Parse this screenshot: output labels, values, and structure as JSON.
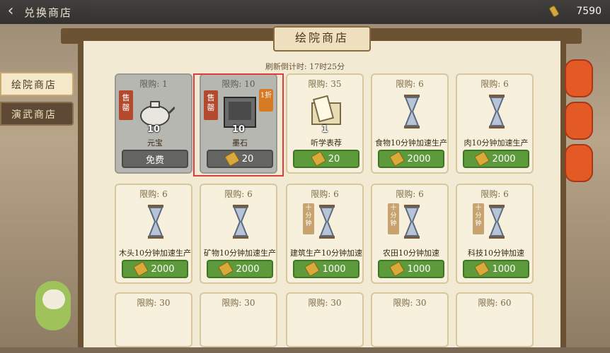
{
  "header": {
    "title": "兑换商店",
    "currency_amount": "7590",
    "back_icon": "chevron-left-icon",
    "currency_icon": "scroll-coin-icon"
  },
  "shop": {
    "title": "绘院商店",
    "refresh": "刷新倒计时: 17时25分"
  },
  "tabs": [
    {
      "label": "绘院商店",
      "active": true
    },
    {
      "label": "演武商店",
      "active": false
    }
  ],
  "items": [
    {
      "limit": "限购: 1",
      "qty": "10",
      "name": "元宝",
      "price": "免费",
      "sold": true,
      "stamp": "售罄",
      "discount": "",
      "tag": ""
    },
    {
      "limit": "限购: 10",
      "qty": "10",
      "name": "墨石",
      "price": "20",
      "sold": true,
      "stamp": "售罄",
      "discount": "1折",
      "tag": ""
    },
    {
      "limit": "限购: 35",
      "qty": "1",
      "name": "听学表荐",
      "price": "20",
      "sold": false,
      "stamp": "",
      "discount": "",
      "tag": ""
    },
    {
      "limit": "限购: 6",
      "qty": "",
      "name": "食物10分钟加速生产",
      "price": "2000",
      "sold": false,
      "stamp": "",
      "discount": "",
      "tag": ""
    },
    {
      "limit": "限购: 6",
      "qty": "",
      "name": "肉10分钟加速生产",
      "price": "2000",
      "sold": false,
      "stamp": "",
      "discount": "",
      "tag": ""
    },
    {
      "limit": "限购: 6",
      "qty": "",
      "name": "木头10分钟加速生产",
      "price": "2000",
      "sold": false,
      "stamp": "",
      "discount": "",
      "tag": ""
    },
    {
      "limit": "限购: 6",
      "qty": "",
      "name": "矿物10分钟加速生产",
      "price": "2000",
      "sold": false,
      "stamp": "",
      "discount": "",
      "tag": ""
    },
    {
      "limit": "限购: 6",
      "qty": "",
      "name": "建筑生产10分钟加速",
      "price": "1000",
      "sold": false,
      "stamp": "",
      "discount": "",
      "tag": "十分钟"
    },
    {
      "limit": "限购: 6",
      "qty": "",
      "name": "农田10分钟加速",
      "price": "1000",
      "sold": false,
      "stamp": "",
      "discount": "",
      "tag": "十分钟"
    },
    {
      "limit": "限购: 6",
      "qty": "",
      "name": "科技10分钟加速",
      "price": "1000",
      "sold": false,
      "stamp": "",
      "discount": "",
      "tag": "十分钟"
    },
    {
      "limit": "限购: 30",
      "qty": "",
      "name": "",
      "price": "",
      "sold": false,
      "stamp": "",
      "discount": "",
      "tag": ""
    },
    {
      "limit": "限购: 30",
      "qty": "",
      "name": "",
      "price": "",
      "sold": false,
      "stamp": "",
      "discount": "",
      "tag": ""
    },
    {
      "limit": "限购: 30",
      "qty": "",
      "name": "",
      "price": "",
      "sold": false,
      "stamp": "",
      "discount": "",
      "tag": ""
    },
    {
      "limit": "限购: 30",
      "qty": "",
      "name": "",
      "price": "",
      "sold": false,
      "stamp": "",
      "discount": "",
      "tag": ""
    },
    {
      "limit": "限购: 60",
      "qty": "",
      "name": "",
      "price": "",
      "sold": false,
      "stamp": "",
      "discount": "",
      "tag": ""
    }
  ]
}
